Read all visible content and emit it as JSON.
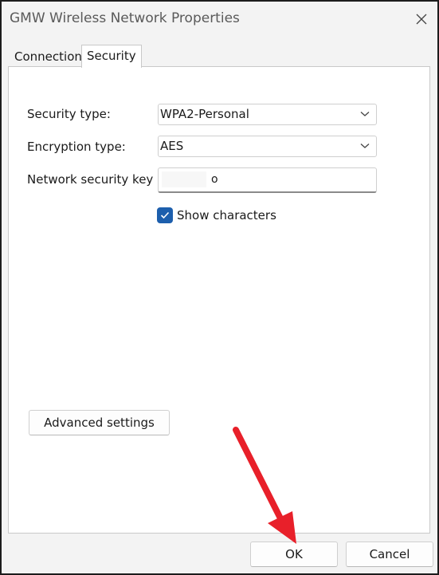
{
  "window": {
    "title": "GMW Wireless Network Properties",
    "close_icon": "close-icon"
  },
  "tabs": [
    {
      "label": "Connection",
      "active": false
    },
    {
      "label": "Security",
      "active": true
    }
  ],
  "security": {
    "security_type_label": "Security type:",
    "security_type_value": "WPA2-Personal",
    "encryption_type_label": "Encryption type:",
    "encryption_type_value": "AES",
    "key_label": "Network security key",
    "key_value": "o",
    "show_characters_label": "Show characters",
    "show_characters_checked": true
  },
  "buttons": {
    "advanced": "Advanced settings",
    "ok": "OK",
    "cancel": "Cancel"
  },
  "annotation": {
    "arrow_color": "#e8202a",
    "points_to": "OK button"
  },
  "colors": {
    "accent": "#1d5fad",
    "window_bg": "#f3f3f3"
  }
}
